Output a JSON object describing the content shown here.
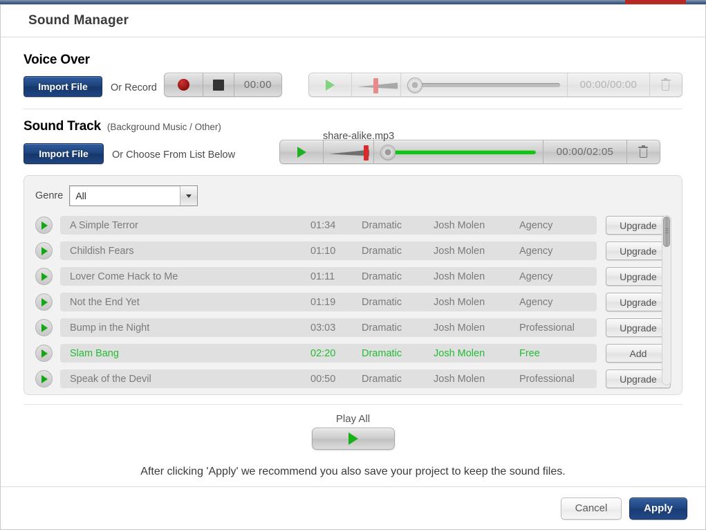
{
  "dialog": {
    "title": "Sound Manager"
  },
  "voice_over": {
    "heading": "Voice Over",
    "import_label": "Import File",
    "or_label": "Or Record",
    "record_timer": "00:00",
    "player": {
      "timecode": "00:00/00:00",
      "progress_percent": 0,
      "volume_percent": 50,
      "enabled": false
    }
  },
  "sound_track": {
    "heading": "Sound Track",
    "subheading": "(Background Music / Other)",
    "import_label": "Import File",
    "or_label": "Or Choose From List Below",
    "filename": "share-alike.mp3",
    "player": {
      "timecode": "00:00/02:05",
      "progress_percent": 100,
      "volume_percent": 100,
      "enabled": true
    }
  },
  "genre": {
    "label": "Genre",
    "selected": "All"
  },
  "tracks": [
    {
      "title": "A Simple Terror",
      "duration": "01:34",
      "genre": "Dramatic",
      "artist": "Josh Molen",
      "license": "Agency",
      "action": "Upgrade",
      "free": false
    },
    {
      "title": "Childish Fears",
      "duration": "01:10",
      "genre": "Dramatic",
      "artist": "Josh Molen",
      "license": "Agency",
      "action": "Upgrade",
      "free": false
    },
    {
      "title": "Lover Come Hack to Me",
      "duration": "01:11",
      "genre": "Dramatic",
      "artist": "Josh Molen",
      "license": "Agency",
      "action": "Upgrade",
      "free": false
    },
    {
      "title": "Not the End Yet",
      "duration": "01:19",
      "genre": "Dramatic",
      "artist": "Josh Molen",
      "license": "Agency",
      "action": "Upgrade",
      "free": false
    },
    {
      "title": "Bump in the Night",
      "duration": "03:03",
      "genre": "Dramatic",
      "artist": "Josh Molen",
      "license": "Professional",
      "action": "Upgrade",
      "free": false
    },
    {
      "title": "Slam Bang",
      "duration": "02:20",
      "genre": "Dramatic",
      "artist": "Josh Molen",
      "license": "Free",
      "action": "Add",
      "free": true
    },
    {
      "title": "Speak of the Devil",
      "duration": "00:50",
      "genre": "Dramatic",
      "artist": "Josh Molen",
      "license": "Professional",
      "action": "Upgrade",
      "free": false
    }
  ],
  "play_all": {
    "label": "Play All"
  },
  "note": "After clicking 'Apply' we recommend you also save your project to keep the sound files.",
  "footer": {
    "cancel": "Cancel",
    "apply": "Apply"
  },
  "colors": {
    "accent_blue": "#204480",
    "free_green": "#22bb33",
    "play_green": "#18b018",
    "record_red": "#9d1313",
    "progress_green": "#14c414"
  }
}
